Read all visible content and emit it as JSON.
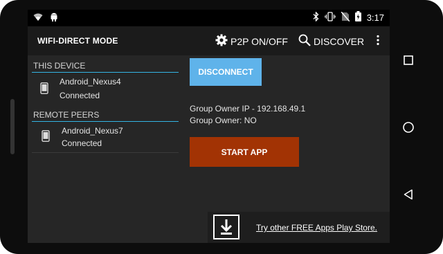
{
  "statusbar": {
    "time": "3:17"
  },
  "appbar": {
    "title": "WIFI-DIRECT MODE",
    "p2p_label": "P2P ON/OFF",
    "discover_label": "DISCOVER"
  },
  "this_device": {
    "header": "THIS DEVICE",
    "name": "Android_Nexus4",
    "status": "Connected"
  },
  "remote_peers": {
    "header": "REMOTE PEERS",
    "items": [
      {
        "name": "Android_Nexus7",
        "status": "Connected"
      }
    ]
  },
  "actions": {
    "disconnect_label": "DISCONNECT",
    "start_app_label": "START APP"
  },
  "group_info": {
    "owner_ip": "Group Owner IP - 192.168.49.1",
    "owner_flag": "Group Owner: NO"
  },
  "ad": {
    "link_text": "Try other FREE Apps Play Store."
  },
  "colors": {
    "accent": "#33b5e5",
    "disconnect_bg": "#5fb3ea",
    "start_app_bg": "#a23304"
  },
  "icons": {
    "status_left": [
      "wifi-icon",
      "android-icon"
    ],
    "status_right": [
      "bluetooth-icon",
      "vibrate-icon",
      "no-sim-icon",
      "battery-icon"
    ],
    "nav": [
      "recents-icon",
      "home-icon",
      "back-icon"
    ]
  }
}
